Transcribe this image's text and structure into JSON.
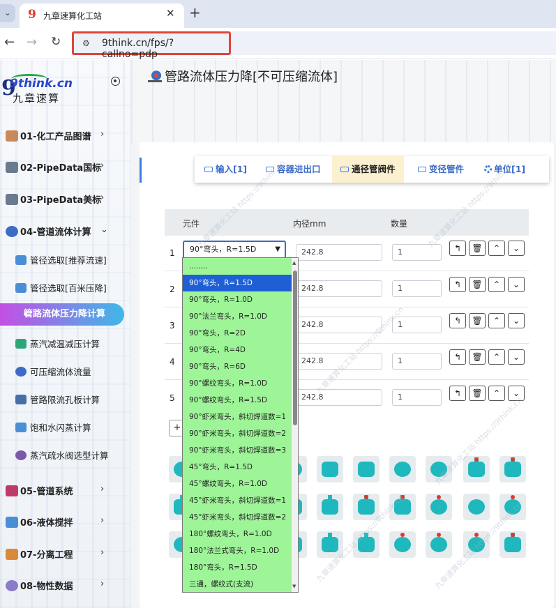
{
  "browser": {
    "tab_title": "九章速算化工站",
    "url": "9think.cn/fps/?callno=pdp"
  },
  "logo": {
    "brand": "9think.cn",
    "brand_cn": "九章速算"
  },
  "sidebar": {
    "sections": [
      {
        "label": "01-化工产品图谱"
      },
      {
        "label": "02-PipeData国标"
      },
      {
        "label": "03-PipeData美标"
      },
      {
        "label": "04-管道流体计算"
      },
      {
        "label": "05-管道系统"
      },
      {
        "label": "06-液体搅拌"
      },
      {
        "label": "07-分离工程"
      },
      {
        "label": "08-物性数据"
      }
    ],
    "sub_items": [
      {
        "label": "管径选取[推荐流速]"
      },
      {
        "label": "管径选取[百米压降]"
      },
      {
        "label": "管路流体压力降计算"
      },
      {
        "label": "蒸汽减温减压计算"
      },
      {
        "label": "可压缩流体流量"
      },
      {
        "label": "管路限流孔板计算"
      },
      {
        "label": "饱和水闪蒸计算"
      },
      {
        "label": "蒸汽疏水阀选型计算"
      }
    ]
  },
  "page": {
    "title": "管路流体压力降[不可压缩流体]",
    "tabs": [
      {
        "label": "输入[1]"
      },
      {
        "label": "容器进出口"
      },
      {
        "label": "通径管阀件"
      },
      {
        "label": "变径管件"
      },
      {
        "label": "单位[1]"
      }
    ],
    "table": {
      "headers": [
        "元件",
        "内径mm",
        "数量"
      ],
      "rows": [
        {
          "num": "1",
          "component": "90°弯头，R=1.5D",
          "diameter": "242.8",
          "qty": "1"
        },
        {
          "num": "2",
          "diameter": "242.8",
          "qty": "1"
        },
        {
          "num": "3",
          "diameter": "242.8",
          "qty": "1"
        },
        {
          "num": "4",
          "diameter": "242.8",
          "qty": "1"
        },
        {
          "num": "5",
          "diameter": "242.8",
          "qty": "1"
        }
      ],
      "add_button": "+"
    },
    "dropdown_options": [
      "........",
      "90°弯头，R=1.5D",
      "90°弯头，R=1.0D",
      "90°法兰弯头，R=1.0D",
      "90°弯头，R=2D",
      "90°弯头，R=4D",
      "90°弯头，R=6D",
      "90°螺纹弯头，R=1.0D",
      "90°螺纹弯头，R=1.5D",
      "90°虾米弯头，斜切焊道数=1",
      "90°虾米弯头，斜切焊道数=2",
      "90°虾米弯头，斜切焊道数=3",
      "45°弯头，R=1.5D",
      "45°螺纹弯头，R=1.0D",
      "45°虾米弯头，斜切焊道数=1",
      "45°虾米弯头，斜切焊道数=2",
      "180°螺纹弯头，R=1.0D",
      "180°法兰式弯头，R=1.0D",
      "180°弯头，R=1.5D",
      "三通，螺纹式(支流)"
    ],
    "selected_option_index": 1,
    "watermark": "九章速算化工站 https://9think.cn"
  },
  "colors": {
    "accent": "#3d6cc6",
    "dropdown_bg": "#9ef598",
    "highlight": "#1f5fd6",
    "active_tab": "#fbf0cf",
    "url_box": "#e0453a"
  }
}
